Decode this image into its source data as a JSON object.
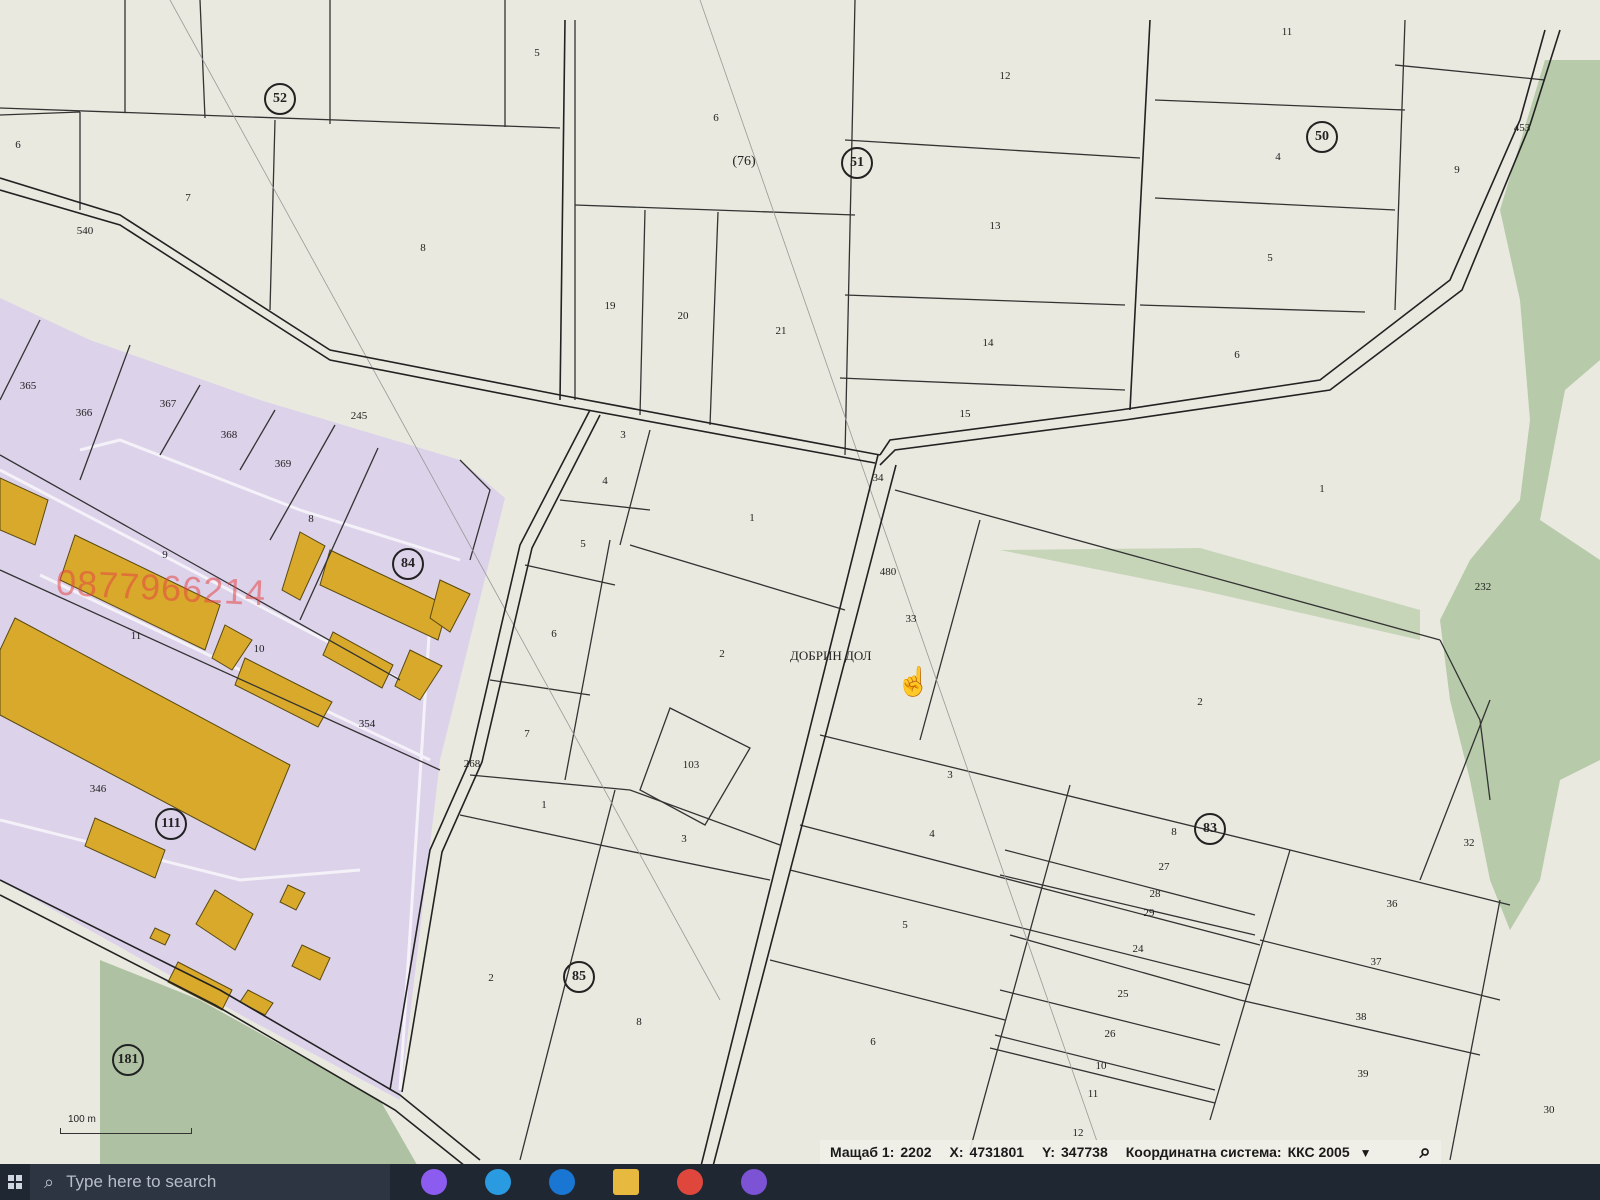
{
  "map": {
    "village_label": "ДОБРИН ДОЛ",
    "watermark_phone": "0877966214",
    "scale_bar_label": "100 m",
    "blocks": [
      "52",
      "(76)",
      "51",
      "50",
      "84",
      "111",
      "85",
      "83",
      "181"
    ],
    "parcels": [
      "6",
      "7",
      "8",
      "5",
      "6",
      "12",
      "11",
      "4",
      "9",
      "453",
      "13",
      "5",
      "14",
      "6",
      "19",
      "20",
      "21",
      "15",
      "540",
      "365",
      "366",
      "367",
      "368",
      "369",
      "245",
      "3",
      "4",
      "5",
      "6",
      "7",
      "1",
      "34",
      "1",
      "9",
      "8",
      "480",
      "33",
      "232",
      "2",
      "2",
      "10",
      "11",
      "354",
      "103",
      "268",
      "1",
      "346",
      "3",
      "3",
      "4",
      "8",
      "27",
      "28",
      "29",
      "32",
      "36",
      "24",
      "5",
      "2",
      "25",
      "37",
      "8",
      "6",
      "26",
      "38",
      "10",
      "11",
      "39",
      "12",
      "30"
    ],
    "colors": {
      "paper": "#e9e9df",
      "industrial_zone": "#dcd2ea",
      "building": "#d8a92a",
      "forest": "#aec4a0",
      "road_line": "#222222"
    }
  },
  "status": {
    "scale_label": "Мащаб 1:",
    "scale_value": "2202",
    "x_label": "X:",
    "x_value": "4731801",
    "y_label": "Y:",
    "y_value": "347738",
    "crs_label": "Координатна система:",
    "crs_value": "ККС 2005",
    "dropdown_icon": "chevron-down-icon",
    "search_icon": "magnifier-icon"
  },
  "taskbar": {
    "search_placeholder": "Type here to search",
    "apps": [
      {
        "icon": "copilot-icon",
        "color": "#8c5cf0"
      },
      {
        "icon": "edge-icon",
        "color": "#2a9be0"
      },
      {
        "icon": "outlook-icon",
        "color": "#1976d2"
      },
      {
        "icon": "file-explorer-icon",
        "color": "#e7b93e"
      },
      {
        "icon": "chrome-icon",
        "color": "#e0473c"
      },
      {
        "icon": "viber-icon",
        "color": "#7b53d4"
      }
    ]
  }
}
